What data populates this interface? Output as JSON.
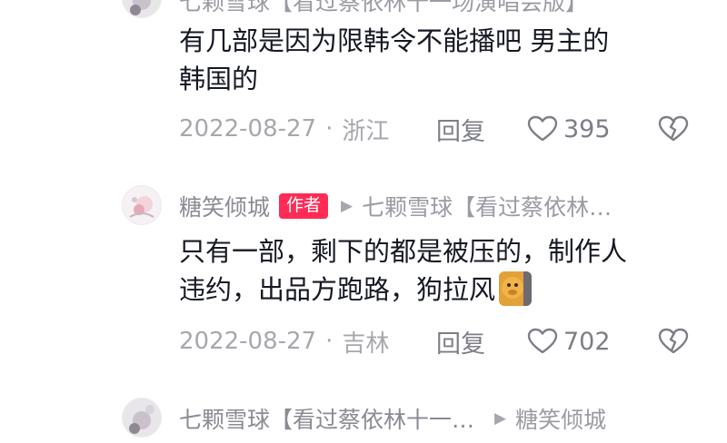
{
  "top": {
    "partial_header": "七颗雪球【看过蔡依林十一场演唱会版】",
    "comment_line1": "有几部是因为限韩令不能播吧 男主的",
    "comment_line2": "韩国的",
    "date": "2022-08-27",
    "separator": "·",
    "location": "浙江",
    "reply_label": "回复",
    "likes": "395"
  },
  "middle": {
    "user_name": "糖笑倾城",
    "author_tag": "作者",
    "reply_to": "七颗雪球【看过蔡依林…",
    "comment_line1": "只有一部，剩下的都是被压的，制作人",
    "comment_line2": "违约，出品方跑路，狗拉风",
    "emoji_name": "doge-emoji",
    "date": "2022-08-27",
    "separator": "·",
    "location": "吉林",
    "reply_label": "回复",
    "likes": "702"
  },
  "bottom": {
    "user_name": "七颗雪球【看过蔡依林十一…",
    "reply_to": "糖笑倾城"
  },
  "colors": {
    "accent": "#fe2c55",
    "text_primary": "#161823",
    "text_secondary": "#9a9ba3"
  }
}
